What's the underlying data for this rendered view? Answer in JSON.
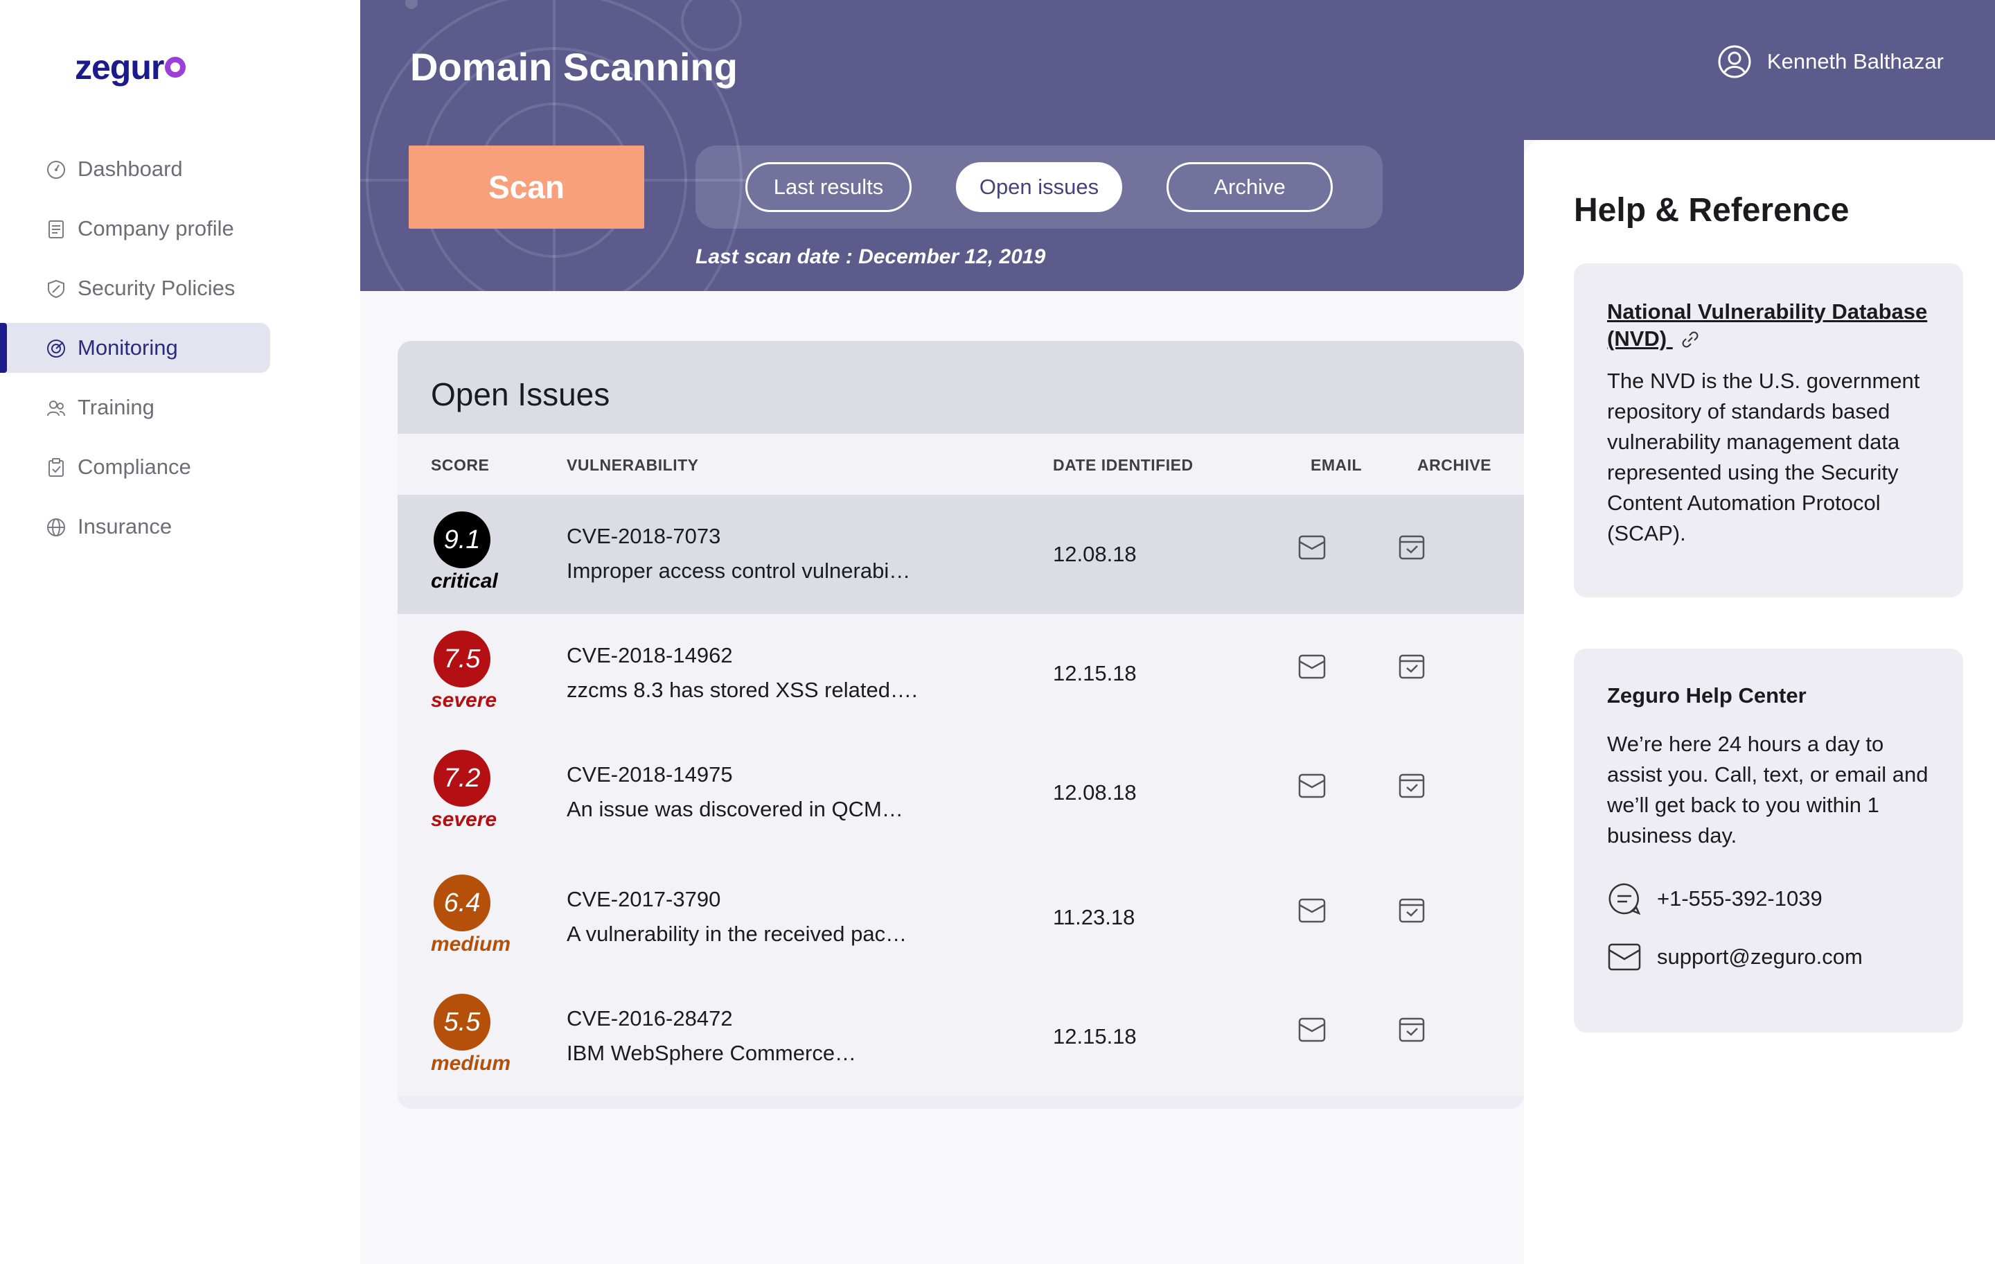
{
  "brand": {
    "name": "zegur"
  },
  "sidebar": {
    "items": [
      {
        "label": "Dashboard",
        "icon": "speedometer-icon",
        "active": false
      },
      {
        "label": "Company profile",
        "icon": "document-icon",
        "active": false
      },
      {
        "label": "Security Policies",
        "icon": "shield-icon",
        "active": false
      },
      {
        "label": "Monitoring",
        "icon": "radar-icon",
        "active": true
      },
      {
        "label": "Training",
        "icon": "people-icon",
        "active": false
      },
      {
        "label": "Compliance",
        "icon": "clipboard-icon",
        "active": false
      },
      {
        "label": "Insurance",
        "icon": "globe-icon",
        "active": false
      }
    ]
  },
  "header": {
    "title": "Domain Scanning",
    "user_name": "Kenneth Balthazar",
    "scan_label": "Scan",
    "tabs": [
      {
        "label": "Last results",
        "active": false
      },
      {
        "label": "Open issues",
        "active": true
      },
      {
        "label": "Archive",
        "active": false
      }
    ],
    "last_scan": "Last scan date : December 12, 2019"
  },
  "issues": {
    "title": "Open Issues",
    "columns": {
      "score": "SCORE",
      "vulnerability": "VULNERABILITY",
      "date": "DATE IDENTIFIED",
      "email": "EMAIL",
      "archive": "ARCHIVE"
    },
    "rows": [
      {
        "score": "9.1",
        "level": "critical",
        "cve": "CVE-2018-7073",
        "desc": "Improper access control vulnerabi…",
        "date": "12.08.18"
      },
      {
        "score": "7.5",
        "level": "severe",
        "cve": "CVE-2018-14962",
        "desc": "zzcms 8.3 has stored XSS related….",
        "date": "12.15.18"
      },
      {
        "score": "7.2",
        "level": "severe",
        "cve": "CVE-2018-14975",
        "desc": "An issue was discovered in QCM…",
        "date": "12.08.18"
      },
      {
        "score": "6.4",
        "level": "medium",
        "cve": "CVE-2017-3790",
        "desc": "A vulnerability in the received pac…",
        "date": "11.23.18"
      },
      {
        "score": "5.5",
        "level": "medium",
        "cve": "CVE-2016-28472",
        "desc": "IBM WebSphere Commerce…",
        "date": "12.15.18"
      }
    ]
  },
  "colors": {
    "header": "#5c5b8c",
    "scan_button": "#f89f7c",
    "critical": "#000000",
    "severe": "#b40f12",
    "medium": "#b5500b",
    "brand": "#1b1b8c"
  },
  "help": {
    "title": "Help & Reference",
    "nvd_link": "National Vulnerability Database (NVD)",
    "nvd_body": "The NVD is the U.S. government repository of standards based vulnerability management data represented using the Security Content Automation Protocol (SCAP).",
    "center_title": "Zeguro Help Center",
    "center_body": "We’re here 24 hours a day to assist you.  Call, text, or email and we’ll get back to you within 1 business day.",
    "phone": "+1-555-392-1039",
    "email": "support@zeguro.com"
  }
}
